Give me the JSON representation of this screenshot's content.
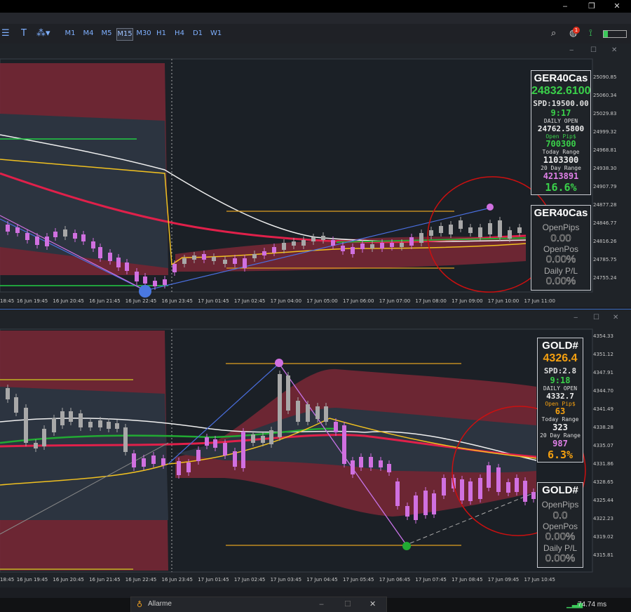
{
  "window_controls": {
    "minimize": "‒",
    "restore": "❐",
    "close": "✕"
  },
  "toolbar": {
    "timeframes": [
      "M1",
      "M4",
      "M5",
      "M15",
      "M30",
      "H1",
      "H4",
      "D1",
      "W1"
    ],
    "active_timeframe": "M15",
    "notification_count": "1"
  },
  "chart1": {
    "symbol": "GER40Cas",
    "price": "24832.6100",
    "spread": "SPD:19500.00",
    "timer": "9:17",
    "daily_open_label": "DAILY OPEN",
    "daily_open": "24762.5800",
    "open_pips_label": "Open Pip$",
    "open_pips": "700300",
    "today_range_label": "Today Range",
    "today_range": "1103300",
    "range20_label": "20 Day Range",
    "range20": "4213891",
    "pct": "16.6%",
    "pos_symbol": "GER40Cas",
    "pos_openpips_label": "OpenPips",
    "pos_openpips": "0.00",
    "pos_openpos_label": "OpenPos",
    "pos_openpos": "0.00%",
    "pos_dailypl_label": "Daily P/L",
    "pos_dailypl": "0.00%",
    "y_labels": [
      "25090.85",
      "25060.34",
      "25029.83",
      "24999.32",
      "24968.81",
      "24938.30",
      "24907.79",
      "24877.28",
      "24846.77",
      "24816.26",
      "24785.75",
      "24755.24"
    ],
    "x_labels": [
      "18:45",
      "16 Jun 19:45",
      "16 Jun 20:45",
      "16 Jun 21:45",
      "16 Jun 22:45",
      "16 Jun 23:45",
      "17 Jun 01:45",
      "17 Jun 02:45",
      "17 Jun 04:00",
      "17 Jun 05:00",
      "17 Jun 06:00",
      "17 Jun 07:00",
      "17 Jun 08:00",
      "17 Jun 09:00",
      "17 Jun 10:00",
      "17 Jun 11:00"
    ]
  },
  "chart2": {
    "symbol": "GOLD#",
    "price": "4326.4",
    "spread": "SPD:2.8",
    "timer": "9:18",
    "daily_open_label": "DAILY OPEN",
    "daily_open": "4332.7",
    "open_pips_label": "Open Pip$",
    "open_pips": "63",
    "today_range_label": "Today Range",
    "today_range": "323",
    "range20_label": "20 Day Range",
    "range20": "987",
    "pct": "6.3%",
    "pos_symbol": "GOLD#",
    "pos_openpips_label": "OpenPips",
    "pos_openpips": "0.0",
    "pos_openpos_label": "OpenPos",
    "pos_openpos": "0.00%",
    "pos_dailypl_label": "Daily P/L",
    "pos_dailypl": "0.00%",
    "y_labels": [
      "4354.33",
      "4351.12",
      "4347.91",
      "4344.70",
      "4341.49",
      "4338.28",
      "4335.07",
      "4331.86",
      "4328.65",
      "4325.44",
      "4322.23",
      "4319.02",
      "4315.81"
    ],
    "x_labels": [
      "18:45",
      "16 Jun 19:45",
      "16 Jun 20:45",
      "16 Jun 21:45",
      "16 Jun 22:45",
      "16 Jun 23:45",
      "17 Jun 01:45",
      "17 Jun 02:45",
      "17 Jun 03:45",
      "17 Jun 04:45",
      "17 Jun 05:45",
      "17 Jun 06:45",
      "17 Jun 07:45",
      "17 Jun 08:45",
      "17 Jun 09:45",
      "17 Jun 10:45"
    ]
  },
  "bottom": {
    "alarm_label": "Allarme",
    "ping": "74.74 ms"
  }
}
